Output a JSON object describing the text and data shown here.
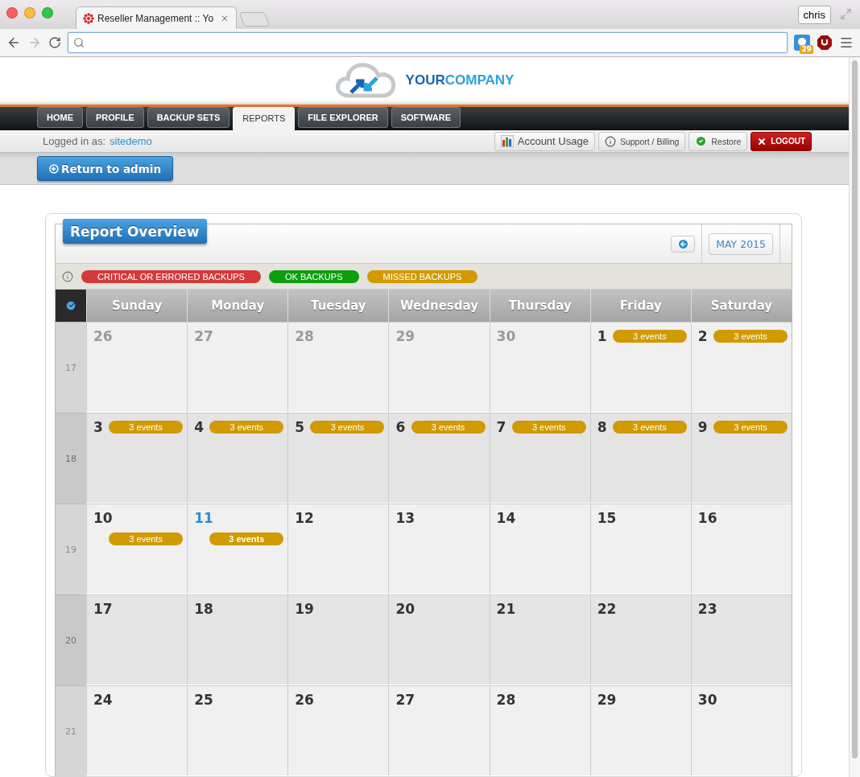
{
  "browser": {
    "tab_title": "Reseller Management :: Yo",
    "profile": "chris",
    "extension_badge": "29"
  },
  "header": {
    "logo_bold": "YOUR",
    "logo_light": "COMPANY"
  },
  "nav": [
    {
      "label": "HOME",
      "selected": false
    },
    {
      "label": "PROFILE",
      "selected": false
    },
    {
      "label": "BACKUP SETS",
      "selected": false
    },
    {
      "label": "REPORTS",
      "selected": true
    },
    {
      "label": "FILE EXPLORER",
      "selected": false
    },
    {
      "label": "SOFTWARE",
      "selected": false
    }
  ],
  "user_bar": {
    "label": "Logged in as:",
    "user": "sitedemo",
    "actions": [
      {
        "kind": "usage",
        "label": "Account Usage"
      },
      {
        "kind": "info",
        "label": "Support / Billing"
      },
      {
        "kind": "ok",
        "label": "Restore"
      },
      {
        "kind": "logout",
        "label": "LOGOUT"
      }
    ]
  },
  "return_button": "Return to admin",
  "report": {
    "title": "Report Overview",
    "month": "MAY 2015",
    "legend": [
      {
        "label": "CRITICAL OR ERRORED BACKUPS",
        "color": "#d33a3a"
      },
      {
        "label": "OK BACKUPS",
        "color": "#0d9e0d"
      },
      {
        "label": "MISSED BACKUPS",
        "color": "#d19a00"
      }
    ],
    "weekdays": [
      "Sunday",
      "Monday",
      "Tuesday",
      "Wednesday",
      "Thursday",
      "Friday",
      "Saturday"
    ],
    "weeks": [
      {
        "number": "17",
        "days": [
          {
            "day": "26",
            "muted": true,
            "today": false
          },
          {
            "day": "27",
            "muted": true,
            "today": false
          },
          {
            "day": "28",
            "muted": true,
            "today": false
          },
          {
            "day": "29",
            "muted": true,
            "today": false
          },
          {
            "day": "30",
            "muted": true,
            "today": false
          },
          {
            "day": "1",
            "muted": false,
            "today": false,
            "events": "3 events"
          },
          {
            "day": "2",
            "muted": false,
            "today": false,
            "events": "3 events"
          }
        ]
      },
      {
        "number": "18",
        "days": [
          {
            "day": "3",
            "muted": false,
            "today": false,
            "events": "3 events"
          },
          {
            "day": "4",
            "muted": false,
            "today": false,
            "events": "3 events"
          },
          {
            "day": "5",
            "muted": false,
            "today": false,
            "events": "3 events"
          },
          {
            "day": "6",
            "muted": false,
            "today": false,
            "events": "3 events"
          },
          {
            "day": "7",
            "muted": false,
            "today": false,
            "events": "3 events"
          },
          {
            "day": "8",
            "muted": false,
            "today": false,
            "events": "3 events"
          },
          {
            "day": "9",
            "muted": false,
            "today": false,
            "events": "3 events"
          }
        ]
      },
      {
        "number": "19",
        "days": [
          {
            "day": "10",
            "muted": false,
            "today": false,
            "events": "3 events"
          },
          {
            "day": "11",
            "muted": false,
            "today": true,
            "events": "3 events"
          },
          {
            "day": "12",
            "muted": false,
            "today": false
          },
          {
            "day": "13",
            "muted": false,
            "today": false
          },
          {
            "day": "14",
            "muted": false,
            "today": false
          },
          {
            "day": "15",
            "muted": false,
            "today": false
          },
          {
            "day": "16",
            "muted": false,
            "today": false
          }
        ]
      },
      {
        "number": "20",
        "days": [
          {
            "day": "17",
            "muted": false,
            "today": false
          },
          {
            "day": "18",
            "muted": false,
            "today": false
          },
          {
            "day": "19",
            "muted": false,
            "today": false
          },
          {
            "day": "20",
            "muted": false,
            "today": false
          },
          {
            "day": "21",
            "muted": false,
            "today": false
          },
          {
            "day": "22",
            "muted": false,
            "today": false
          },
          {
            "day": "23",
            "muted": false,
            "today": false
          }
        ]
      },
      {
        "number": "21",
        "days": [
          {
            "day": "24",
            "muted": false,
            "today": false
          },
          {
            "day": "25",
            "muted": false,
            "today": false
          },
          {
            "day": "26",
            "muted": false,
            "today": false
          },
          {
            "day": "27",
            "muted": false,
            "today": false
          },
          {
            "day": "28",
            "muted": false,
            "today": false
          },
          {
            "day": "29",
            "muted": false,
            "today": false
          },
          {
            "day": "30",
            "muted": false,
            "today": false
          }
        ]
      }
    ]
  }
}
